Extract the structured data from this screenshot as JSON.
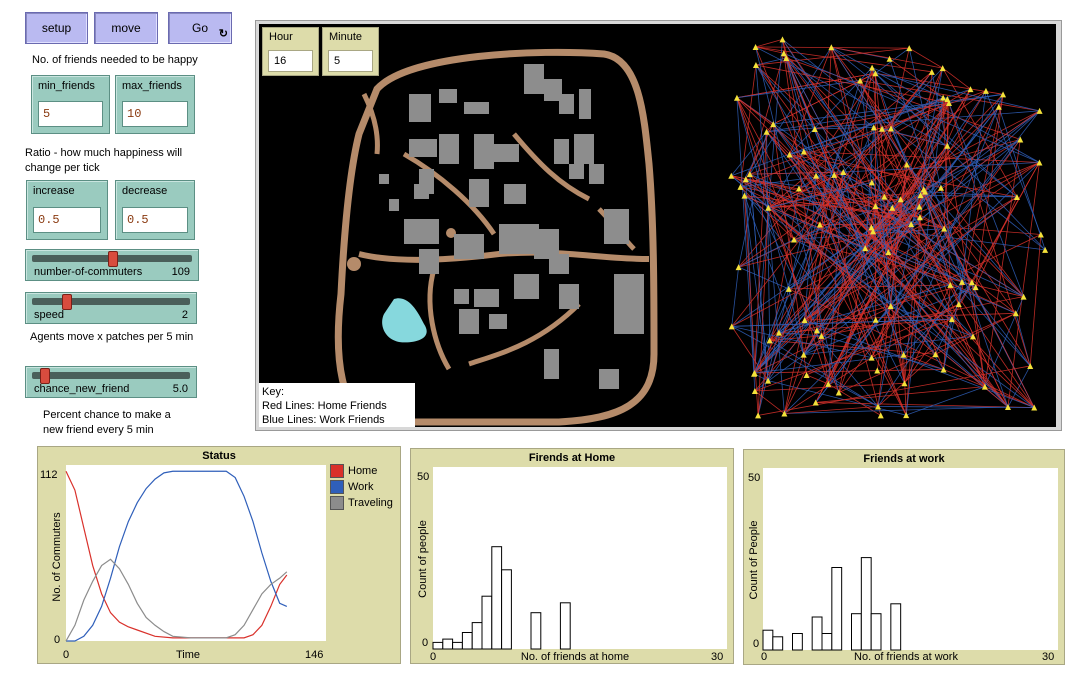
{
  "buttons": {
    "setup": "setup",
    "move": "move",
    "go": "Go",
    "go_forever_icon": "forever-icon"
  },
  "labels": {
    "friends_needed": "No. of friends needed to be happy",
    "ratio": "Ratio - how much happiness will change per tick",
    "agents_move": "Agents move x patches per 5 min",
    "percent_chance": "Percent chance to make a new friend every 5 min"
  },
  "inputs": {
    "min_friends": {
      "label": "min_friends",
      "value": "5"
    },
    "max_friends": {
      "label": "max_friends",
      "value": "10"
    },
    "increase": {
      "label": "increase",
      "value": "0.5"
    },
    "decrease": {
      "label": "decrease",
      "value": "0.5"
    }
  },
  "sliders": {
    "commuters": {
      "name": "number-of-commuters",
      "value": "109",
      "level": 0.5
    },
    "speed": {
      "name": "speed",
      "value": "2",
      "level": 0.2
    },
    "chance": {
      "name": "chance_new_friend",
      "value": "5.0",
      "level": 0.05
    }
  },
  "monitors": {
    "hour": {
      "label": "Hour",
      "value": "16"
    },
    "minute": {
      "label": "Minute",
      "value": "5"
    }
  },
  "key": {
    "title": "Key:",
    "red": "Red Lines: Home Friends",
    "blue": "Blue Lines: Work Friends"
  },
  "colors": {
    "home": "#d9312b",
    "work": "#2f5fba",
    "traveling": "#8c8c8c",
    "road": "#b58b6a",
    "lake": "#86d8dd",
    "building": "#8d8d8d"
  },
  "chart_data": [
    {
      "type": "line",
      "title": "Status",
      "xlabel": "Time",
      "ylabel": "No. of Commuters",
      "xlim": [
        0,
        146
      ],
      "ylim": [
        0,
        112
      ],
      "x_ticks": [
        "0",
        "146"
      ],
      "y_ticks": [
        "0",
        "112"
      ],
      "series": [
        {
          "name": "Home",
          "color": "#d9312b",
          "x": [
            0,
            5,
            10,
            15,
            20,
            25,
            30,
            35,
            40,
            50,
            60,
            70,
            80,
            90,
            100,
            105,
            110,
            115,
            120,
            124
          ],
          "y": [
            108,
            96,
            72,
            48,
            30,
            18,
            12,
            9,
            7,
            3,
            2,
            2,
            2,
            2,
            2,
            4,
            10,
            22,
            36,
            42
          ]
        },
        {
          "name": "Work",
          "color": "#2f5fba",
          "x": [
            0,
            5,
            10,
            15,
            20,
            25,
            30,
            35,
            40,
            45,
            50,
            55,
            60,
            70,
            80,
            90,
            95,
            100,
            105,
            110,
            115,
            120,
            124
          ],
          "y": [
            0,
            0,
            3,
            10,
            22,
            40,
            60,
            76,
            88,
            97,
            103,
            107,
            108,
            108,
            108,
            108,
            104,
            92,
            76,
            56,
            38,
            24,
            22
          ]
        },
        {
          "name": "Traveling",
          "color": "#8c8c8c",
          "x": [
            0,
            5,
            10,
            15,
            20,
            25,
            30,
            35,
            40,
            45,
            50,
            55,
            60,
            70,
            80,
            90,
            95,
            100,
            105,
            110,
            115,
            120,
            124
          ],
          "y": [
            0,
            10,
            26,
            38,
            48,
            52,
            46,
            36,
            24,
            15,
            10,
            6,
            3,
            2,
            2,
            2,
            4,
            10,
            20,
            30,
            36,
            40,
            44
          ]
        }
      ],
      "legend": "right"
    },
    {
      "type": "bar",
      "title": "Firends at Home",
      "xlabel": "No. of friends at home",
      "ylabel": "Count of people",
      "xlim": [
        0,
        30
      ],
      "ylim": [
        0,
        50
      ],
      "x_ticks": [
        "0",
        "30"
      ],
      "y_ticks": [
        "0",
        "50"
      ],
      "bins": [
        0,
        1,
        2,
        3,
        4,
        5,
        6,
        7,
        8,
        9,
        10,
        11,
        12,
        13,
        14,
        15
      ],
      "values": [
        2,
        3,
        2,
        5,
        8,
        16,
        31,
        24,
        0,
        0,
        11,
        0,
        0,
        14,
        0,
        0
      ]
    },
    {
      "type": "bar",
      "title": "Friends at work",
      "xlabel": "No. of friends at work",
      "ylabel": "Count of People",
      "xlim": [
        0,
        30
      ],
      "ylim": [
        0,
        50
      ],
      "x_ticks": [
        "0",
        "30"
      ],
      "y_ticks": [
        "0",
        "50"
      ],
      "bins": [
        0,
        1,
        2,
        3,
        4,
        5,
        6,
        7,
        8,
        9,
        10,
        11,
        12,
        13,
        14,
        15
      ],
      "values": [
        6,
        4,
        0,
        5,
        0,
        10,
        5,
        25,
        0,
        11,
        28,
        11,
        0,
        14,
        0,
        0
      ]
    }
  ]
}
